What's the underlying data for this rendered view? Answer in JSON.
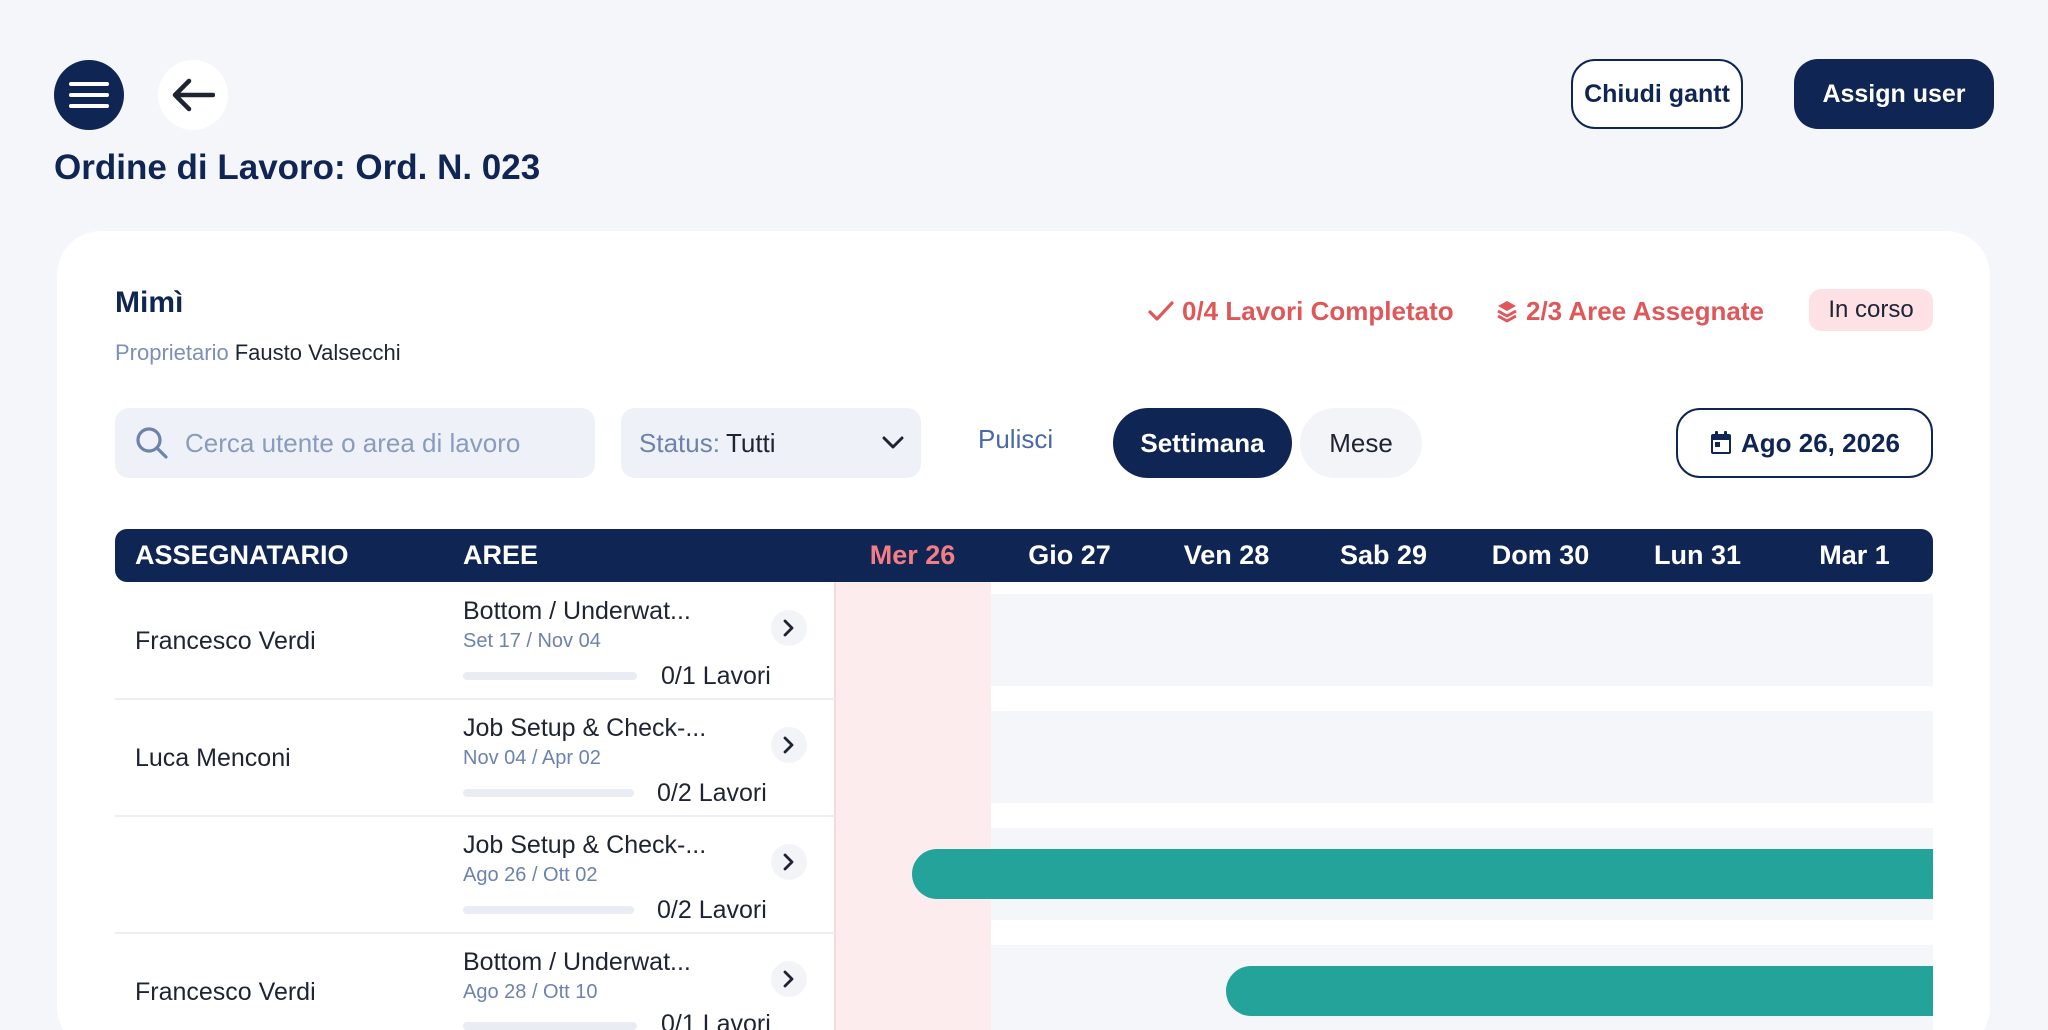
{
  "header": {
    "title": "Ordine di Lavoro: Ord. N. 023",
    "close_gantt_label": "Chiudi gantt",
    "assign_user_label": "Assign user",
    "menu_icon": "hamburger-icon",
    "back_icon": "arrow-left-icon"
  },
  "card": {
    "boat_name": "Mimì",
    "owner_label": "Proprietario",
    "owner_value": "Fausto Valsecchi",
    "stats": {
      "works_completed": "0/4 Lavori Completato",
      "areas_assigned": "2/3 Aree Assegnate"
    },
    "status_badge": "In corso"
  },
  "toolbar": {
    "search_placeholder": "Cerca utente o area di lavoro",
    "status_label": "Status:",
    "status_value": "Tutti",
    "clear_label": "Pulisci",
    "week_label": "Settimana",
    "month_label": "Mese",
    "date_label": "Ago 26, 2026"
  },
  "gantt": {
    "columns": {
      "assignee": "ASSEGNATARIO",
      "areas": "AREE"
    },
    "days": [
      "Mer 26",
      "Gio 27",
      "Ven 28",
      "Sab 29",
      "Dom 30",
      "Lun 31",
      "Mar 1"
    ],
    "today_index": 0,
    "rows": [
      {
        "assignee": "Francesco Verdi",
        "area": "Bottom / Underwat...",
        "dates": "Set 17 / Nov 04",
        "works": "0/1 Lavori",
        "progress": 0
      },
      {
        "assignee": "Luca Menconi",
        "area": "Job Setup & Check-...",
        "dates": "Nov 04 / Apr 02",
        "works": "0/2 Lavori",
        "progress": 0
      },
      {
        "assignee": "",
        "area": "Job Setup & Check-...",
        "dates": "Ago 26 / Ott 02",
        "works": "0/2 Lavori",
        "progress": 0
      },
      {
        "assignee": "Francesco Verdi",
        "area": "Bottom / Underwat...",
        "dates": "Ago 28 / Ott 10",
        "works": "0/1 Lavori",
        "progress": 0
      }
    ],
    "bar_color": "#24a39a",
    "today_color": "#f47e84"
  },
  "colors": {
    "primary": "#0f2554",
    "accent_red": "#e0575a",
    "badge_bg": "#fde1e5",
    "background": "#f5f6fa"
  }
}
